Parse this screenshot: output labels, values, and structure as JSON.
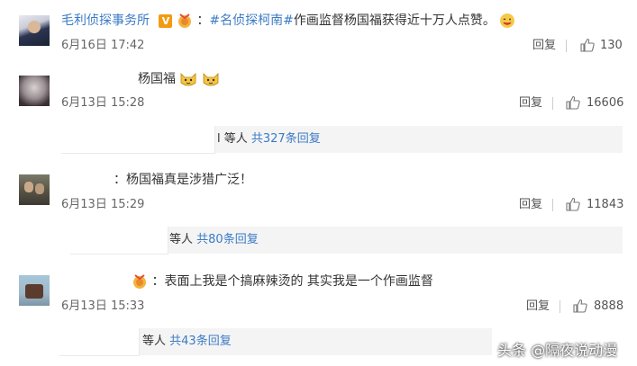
{
  "comments": [
    {
      "author": "毛利侦探事务所",
      "badge": "V",
      "prefix": "：",
      "hashtag": "#名侦探柯南#",
      "text": "作画监督杨国福获得近十万人点赞。",
      "date": "6月16日 17:42",
      "reply_label": "回复",
      "likes": "130"
    },
    {
      "text": "杨国福",
      "date": "6月13日 15:28",
      "reply_label": "回复",
      "likes": "16606",
      "sub_prefix": "l 等人",
      "sub_link": "共327条回复"
    },
    {
      "text": "：杨国福真是涉猎广泛！",
      "date": "6月13日 15:29",
      "reply_label": "回复",
      "likes": "11843",
      "sub_prefix": "等人",
      "sub_link": "共80条回复"
    },
    {
      "text": "：表面上我是个搞麻辣烫的 其实我是一个作画监督",
      "date": "6月13日 15:33",
      "reply_label": "回复",
      "likes": "8888",
      "sub_prefix": "等人",
      "sub_link": "共43条回复"
    }
  ],
  "watermark": "头条 @隔夜说动漫",
  "icons": {
    "thumb": "thumbs-up-icon",
    "badge_emoji": "medal-emoji-icon",
    "cat_emoji": "cat-face-emoji-icon",
    "wink_emoji": "wink-emoji-icon"
  },
  "colors": {
    "link": "#3b7bc6",
    "vip": "#f29b12"
  }
}
